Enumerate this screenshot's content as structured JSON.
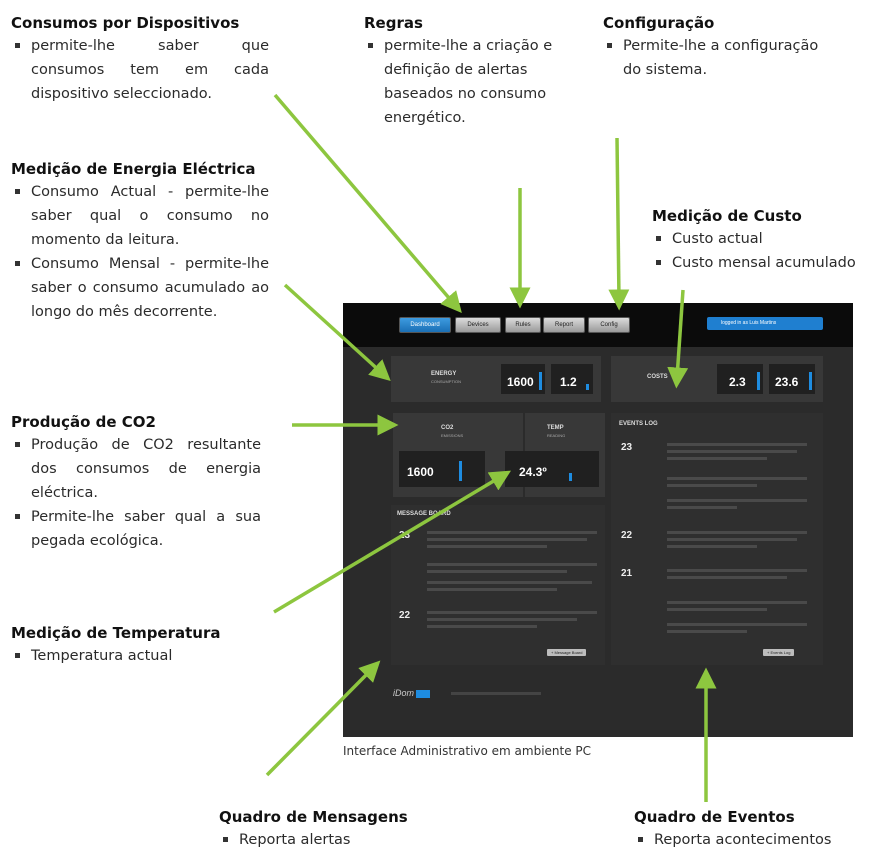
{
  "annotations": {
    "consumos": {
      "title": "Consumos por  Dispositivos",
      "lines": [
        "permite-lhe saber que consumos tem em cada dispositivo seleccionado."
      ]
    },
    "regras": {
      "title": "Regras",
      "lines": [
        "permite-lhe a criação e definição de alertas baseados no consumo energético."
      ]
    },
    "config": {
      "title": "Configuração",
      "lines": [
        "Permite-lhe a configuração do sistema."
      ]
    },
    "energia": {
      "title": "Medição de Energia Eléctrica",
      "lines": [
        "Consumo Actual - permite-lhe saber qual o consumo no momento da leitura.",
        "Consumo Mensal - permite-lhe saber o consumo acumulado ao longo do mês decorrente."
      ]
    },
    "custo": {
      "title": "Medição de Custo",
      "lines": [
        "Custo actual",
        "Custo mensal acumulado"
      ]
    },
    "co2": {
      "title": "Produção de CO2",
      "lines": [
        "Produção de CO2 resultante dos consumos de energia eléctrica.",
        "Permite-lhe saber qual a sua pegada ecológica."
      ]
    },
    "temperatura": {
      "title": "Medição de Temperatura",
      "lines": [
        "Temperatura actual"
      ]
    },
    "mensagens": {
      "title": "Quadro de Mensagens",
      "lines": [
        "Reporta alertas"
      ]
    },
    "eventos": {
      "title": "Quadro de Eventos",
      "lines": [
        "Reporta acontecimentos"
      ]
    }
  },
  "caption": "Interface Administrativo em ambiente PC",
  "screen": {
    "tabs": [
      "Dashboard",
      "Devices",
      "Rules",
      "Report",
      "Config"
    ],
    "active_tab": "Dashboard",
    "user": "logged in as Luis Martins",
    "energy": {
      "label": "ENERGY",
      "sub": "CONSUMPTION",
      "v1": "1600",
      "v2": "1.2"
    },
    "costs": {
      "label": "COSTS",
      "v1": "2.3",
      "v2": "23.6"
    },
    "co2": {
      "label": "CO2",
      "sub": "EMISSIONS",
      "v": "1600"
    },
    "temp": {
      "label": "TEMP",
      "sub": "READING",
      "v": "24.3º"
    },
    "message_board": {
      "title": "MESSAGE BOARD",
      "dates": [
        "23",
        "22"
      ],
      "button": "+ Message Board"
    },
    "events_log": {
      "title": "EVENTS LOG",
      "dates": [
        "23",
        "22",
        "21"
      ],
      "button": "+ Events Log"
    },
    "footer_logo": "iDom"
  },
  "colors": {
    "arrow": "#8dc63f",
    "accent": "#1e8ce0"
  }
}
